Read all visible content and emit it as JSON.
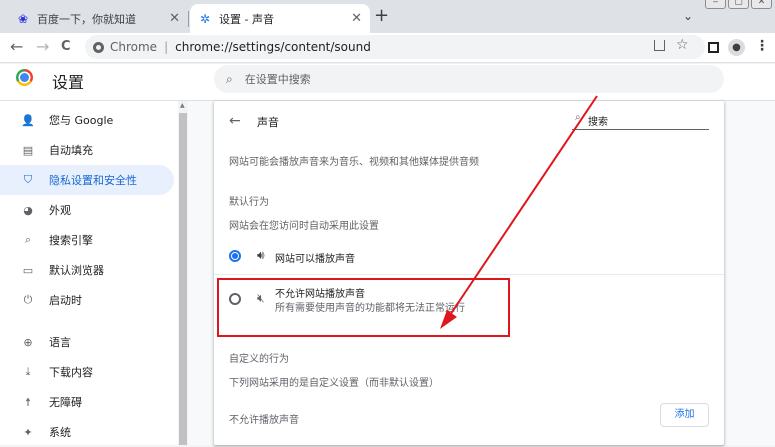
{
  "browser": {
    "tabs": [
      {
        "title": "百度一下，你就知道",
        "favicon": "baidu-paw-icon"
      },
      {
        "title": "设置 - 声音",
        "favicon": "settings-gear-icon",
        "active": true
      }
    ],
    "new_tab": "+",
    "tab_menu": "⌄",
    "window_controls": [
      "‒",
      "▢",
      "✕"
    ],
    "omnibox": {
      "site_label": "Chrome",
      "separator": "|",
      "url": "chrome://settings/content/sound"
    },
    "nav": {
      "back": "←",
      "forward": "→",
      "reload": "C"
    }
  },
  "settings": {
    "title": "设置",
    "search_placeholder": "在设置中搜索",
    "sidebar": [
      {
        "icon": "person-icon",
        "glyph": "👤",
        "label": "您与 Google"
      },
      {
        "icon": "clipboard-icon",
        "glyph": "▤",
        "label": "自动填充"
      },
      {
        "icon": "shield-icon",
        "glyph": "⛉",
        "label": "隐私设置和安全性",
        "active": true
      },
      {
        "icon": "palette-icon",
        "glyph": "◕",
        "label": "外观"
      },
      {
        "icon": "search-icon",
        "glyph": "⌕",
        "label": "搜索引擎"
      },
      {
        "icon": "browser-icon",
        "glyph": "▭",
        "label": "默认浏览器"
      },
      {
        "icon": "power-icon",
        "glyph": "⏻",
        "label": "启动时"
      },
      {
        "icon": "globe-icon",
        "glyph": "⊕",
        "label": "语言"
      },
      {
        "icon": "download-icon",
        "glyph": "⤓",
        "label": "下载内容"
      },
      {
        "icon": "accessibility-icon",
        "glyph": "☨",
        "label": "无障碍"
      },
      {
        "icon": "wrench-icon",
        "glyph": "✦",
        "label": "系统"
      }
    ]
  },
  "sound_page": {
    "back": "←",
    "title": "声音",
    "search_label": "搜索",
    "description": "网站可能会播放声音来为音乐、视频和其他媒体提供音频",
    "default_behavior": {
      "heading": "默认行为",
      "subtitle": "网站会在您访问时自动采用此设置",
      "option_allow": {
        "label": "网站可以播放声音",
        "selected": true
      },
      "option_block": {
        "label": "不允许网站播放声音",
        "sublabel": "所有需要使用声音的功能都将无法正常运行",
        "selected": false
      }
    },
    "custom_behavior": {
      "heading": "自定义的行为",
      "subtitle": "下列网站采用的是自定义设置（而非默认设置）",
      "block_heading": "不允许播放声音",
      "add_button": "添加"
    }
  },
  "colors": {
    "accent": "#1a73e8",
    "annotation": "#e0161e",
    "active_nav_bg": "#e8f0fe"
  }
}
